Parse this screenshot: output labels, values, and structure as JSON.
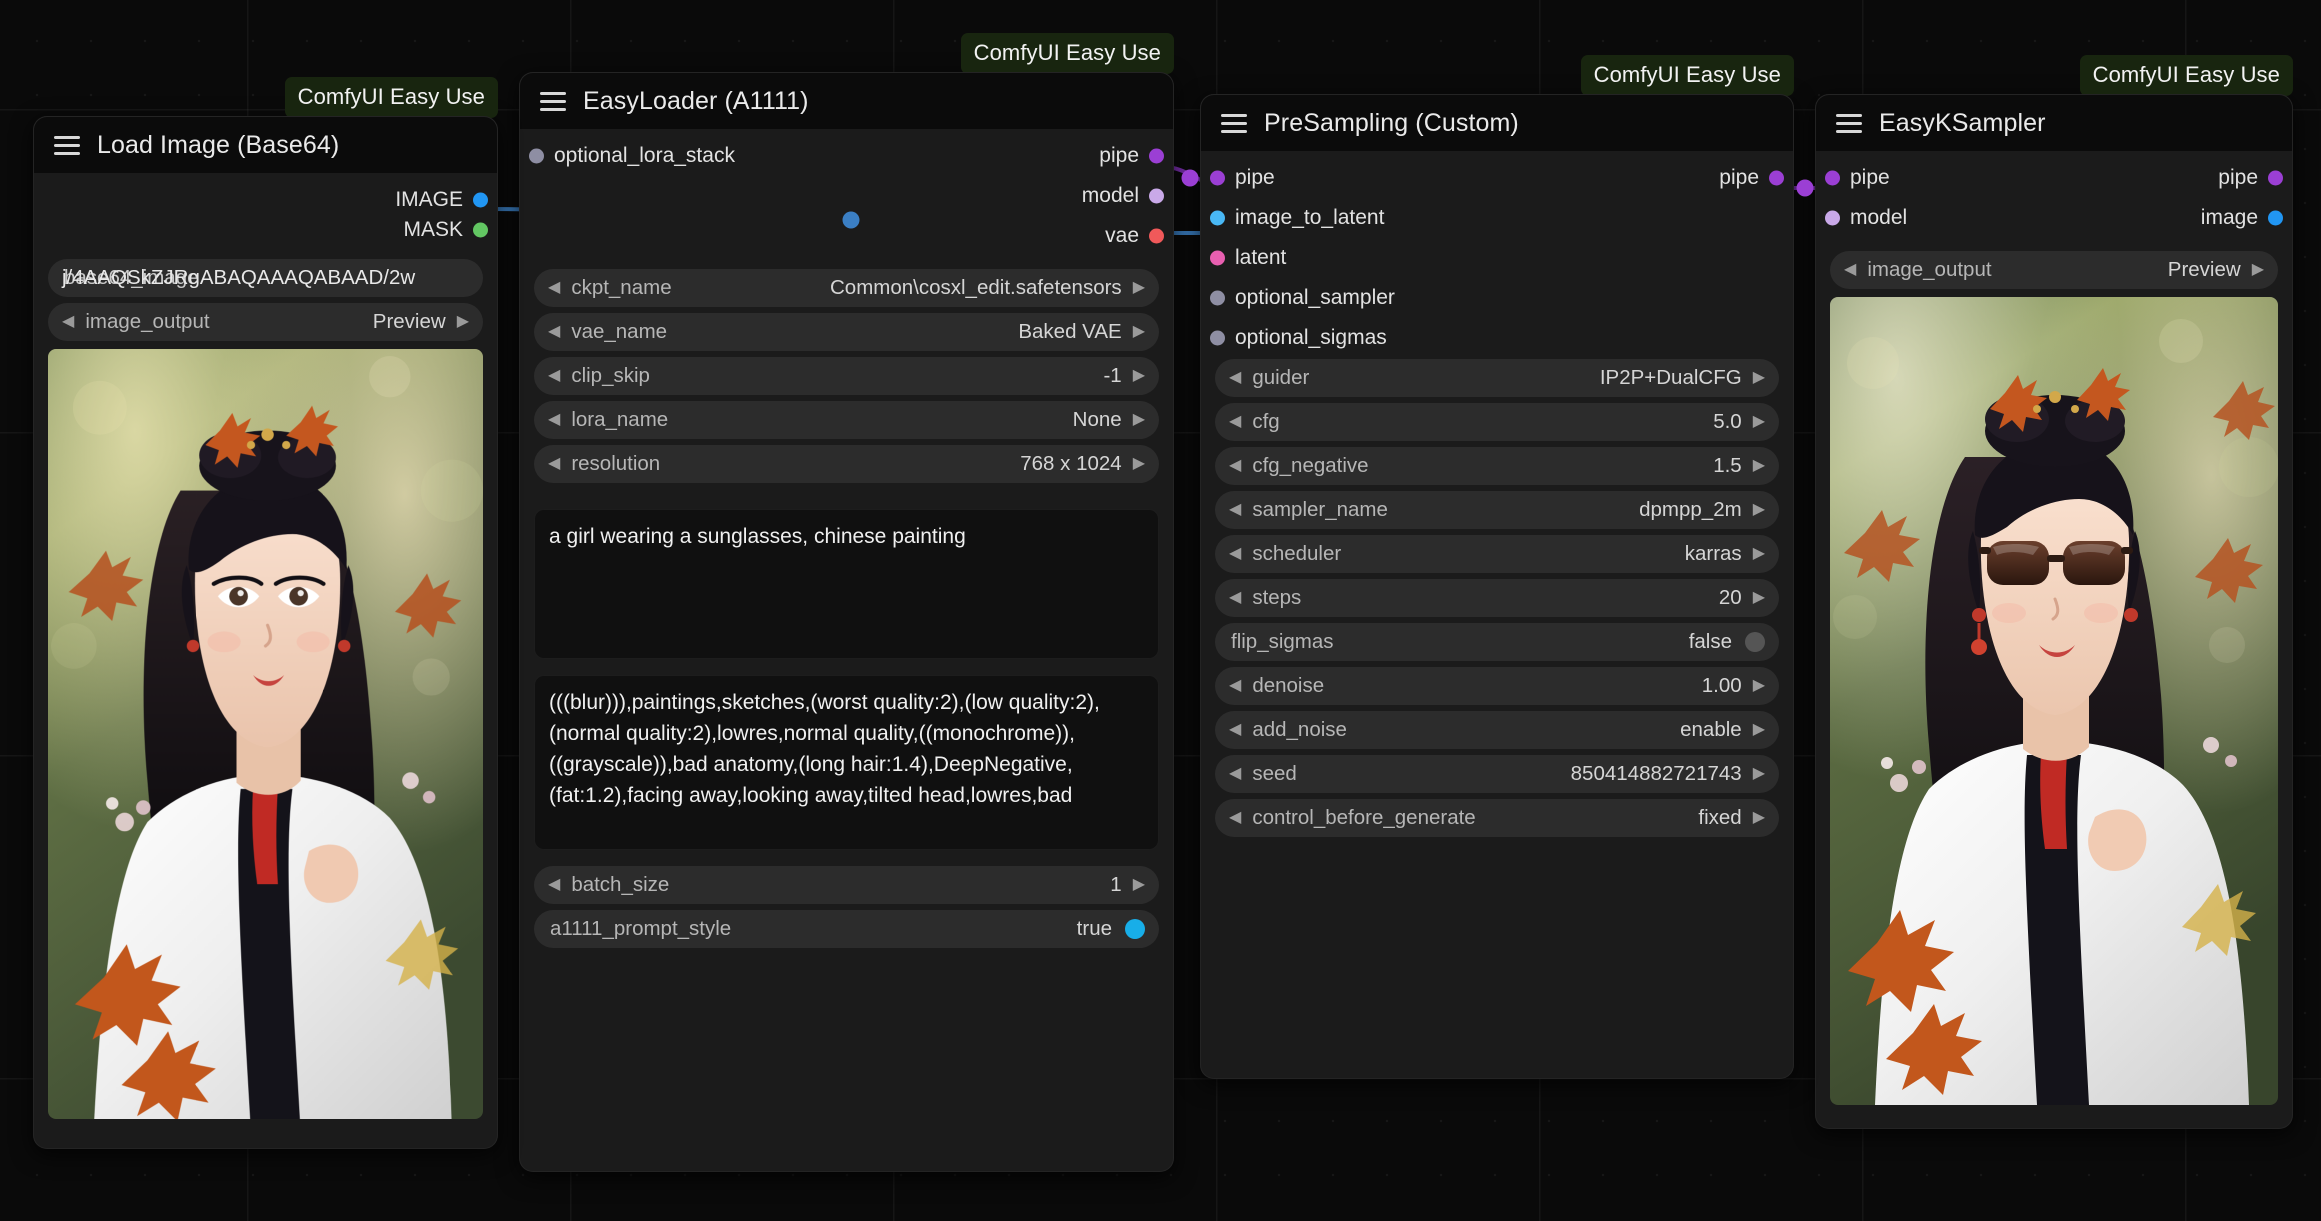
{
  "canvas": {
    "background": "#0a0a0a",
    "grid": "dot-grid"
  },
  "badge_label": "ComfyUI Easy Use",
  "nodes": [
    {
      "id": "load-image-base64",
      "title": "Load Image (Base64)",
      "badge": "ComfyUI Easy Use",
      "outputs": [
        {
          "name": "IMAGE",
          "color": "#2196f3"
        },
        {
          "name": "MASK",
          "color": "#63c763"
        }
      ],
      "widgets": [
        {
          "type": "text",
          "label": "base64_image",
          "value": "j/4AAQSkZJRgABAQAAAQABAAD/2w"
        },
        {
          "type": "combo",
          "label": "image_output",
          "value": "Preview"
        }
      ]
    },
    {
      "id": "easyloader-a1111",
      "title": "EasyLoader (A1111)",
      "badge": "ComfyUI Easy Use",
      "inputs": [
        {
          "name": "optional_lora_stack",
          "color": "#8e8ea3"
        }
      ],
      "outputs": [
        {
          "name": "pipe",
          "color": "#9b3fd4"
        },
        {
          "name": "model",
          "color": "#c9a9e8"
        },
        {
          "name": "vae",
          "color": "#f0595a"
        }
      ],
      "widgets": [
        {
          "type": "combo",
          "label": "ckpt_name",
          "value": "Common\\cosxl_edit.safetensors"
        },
        {
          "type": "combo",
          "label": "vae_name",
          "value": "Baked VAE"
        },
        {
          "type": "combo",
          "label": "clip_skip",
          "value": "-1"
        },
        {
          "type": "combo",
          "label": "lora_name",
          "value": "None"
        },
        {
          "type": "combo",
          "label": "resolution",
          "value": "768 x 1024"
        }
      ],
      "positive_prompt": "a girl wearing a sunglasses, chinese painting",
      "negative_prompt": "(((blur))),paintings,sketches,(worst quality:2),(low quality:2),(normal quality:2),lowres,normal quality,((monochrome)),((grayscale)),bad anatomy,(long hair:1.4),DeepNegative,(fat:1.2),facing away,looking away,tilted head,lowres,bad",
      "widgets_bottom": [
        {
          "type": "combo",
          "label": "batch_size",
          "value": "1"
        },
        {
          "type": "toggle",
          "label": "a1111_prompt_style",
          "value": "true",
          "state": "on"
        }
      ]
    },
    {
      "id": "presampling-custom",
      "title": "PreSampling (Custom)",
      "badge": "ComfyUI Easy Use",
      "inputs": [
        {
          "name": "pipe",
          "color": "#9b3fd4"
        },
        {
          "name": "image_to_latent",
          "color": "#49b8f5"
        },
        {
          "name": "latent",
          "color": "#e85fb0"
        },
        {
          "name": "optional_sampler",
          "color": "#8e8ea3"
        },
        {
          "name": "optional_sigmas",
          "color": "#8e8ea3"
        }
      ],
      "outputs": [
        {
          "name": "pipe",
          "color": "#9b3fd4"
        }
      ],
      "widgets": [
        {
          "type": "combo",
          "label": "guider",
          "value": "IP2P+DualCFG"
        },
        {
          "type": "combo",
          "label": "cfg",
          "value": "5.0"
        },
        {
          "type": "combo",
          "label": "cfg_negative",
          "value": "1.5"
        },
        {
          "type": "combo",
          "label": "sampler_name",
          "value": "dpmpp_2m"
        },
        {
          "type": "combo",
          "label": "scheduler",
          "value": "karras"
        },
        {
          "type": "combo",
          "label": "steps",
          "value": "20"
        },
        {
          "type": "toggle",
          "label": "flip_sigmas",
          "value": "false",
          "state": "off"
        },
        {
          "type": "combo",
          "label": "denoise",
          "value": "1.00"
        },
        {
          "type": "combo",
          "label": "add_noise",
          "value": "enable"
        },
        {
          "type": "combo",
          "label": "seed",
          "value": "850414882721743"
        },
        {
          "type": "combo",
          "label": "control_before_generate",
          "value": "fixed"
        }
      ]
    },
    {
      "id": "easyksampler",
      "title": "EasyKSampler",
      "badge": "ComfyUI Easy Use",
      "inputs": [
        {
          "name": "pipe",
          "color": "#9b3fd4"
        },
        {
          "name": "model",
          "color": "#c9a9e8"
        }
      ],
      "outputs": [
        {
          "name": "pipe",
          "color": "#9b3fd4"
        },
        {
          "name": "image",
          "color": "#2196f3"
        }
      ],
      "widgets": [
        {
          "type": "combo",
          "label": "image_output",
          "value": "Preview"
        }
      ]
    }
  ],
  "links": [
    {
      "from": "load-image-base64.IMAGE",
      "to": "presampling-custom.image_to_latent",
      "color": "#3b7fc4"
    },
    {
      "from": "easyloader-a1111.pipe",
      "to": "presampling-custom.pipe",
      "color": "#7a2fae"
    },
    {
      "from": "presampling-custom.pipe",
      "to": "easyksampler.pipe",
      "color": "#7a2fae"
    }
  ],
  "previews": {
    "load_image": "girl-in-garden-autumn-leaves",
    "ksampler": "girl-in-garden-with-sunglasses"
  },
  "icons": {
    "menu": "hamburger-menu-icon",
    "arrow_left": "◀",
    "arrow_right": "▶"
  }
}
